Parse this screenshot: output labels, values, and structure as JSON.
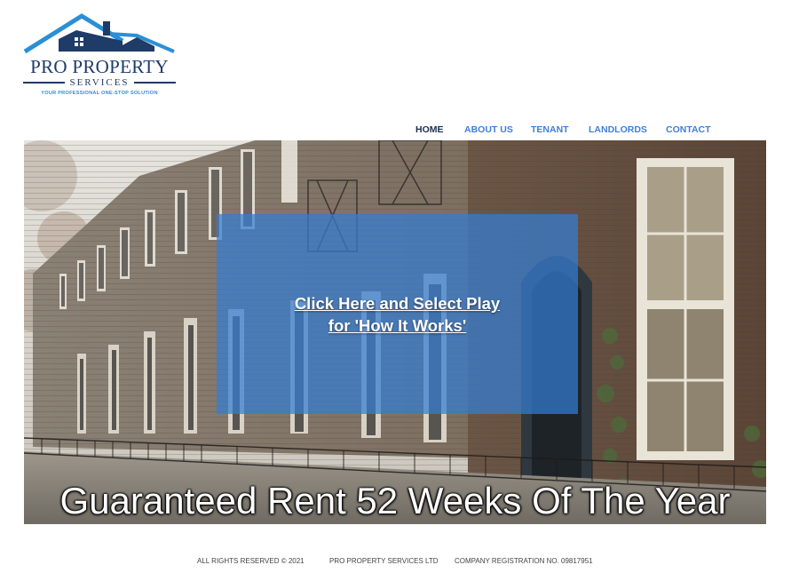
{
  "logo": {
    "title": "PRO PROPERTY",
    "subtitle": "SERVICES",
    "tagline": "YOUR PROFESSIONAL ONE-STOP SOLUTION",
    "icon": "house-roof-logo-icon",
    "colors": {
      "navy": "#1f3b67",
      "blue": "#2b8fd6"
    }
  },
  "nav": {
    "items": [
      {
        "label": "HOME",
        "active": true
      },
      {
        "label": "ABOUT US",
        "active": false
      },
      {
        "label": "TENANT",
        "active": false
      },
      {
        "label": "LANDLORDS",
        "active": false
      },
      {
        "label": "CONTACT",
        "active": false
      }
    ],
    "colors": {
      "active": "#1d2f52",
      "inactive": "#3f7fd9"
    }
  },
  "hero": {
    "image": "terraced-brick-houses-photo",
    "video_link_line1": "Click Here and Select Play",
    "video_link_line2": "for 'How It Works'",
    "headline": "Guaranteed Rent 52 Weeks Of The Year",
    "overlay_color": "#347dd2"
  },
  "footer": {
    "rights": "ALL RIGHTS RESERVED ©  2021",
    "company": "PRO PROPERTY SERVICES LTD",
    "registration": "COMPANY REGISTRATION NO. 09817951"
  }
}
